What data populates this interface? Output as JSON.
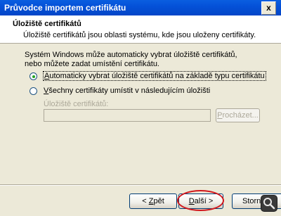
{
  "window": {
    "title": "Průvodce importem certifikátu",
    "close_symbol": "x"
  },
  "header": {
    "title": "Úložiště certifikátů",
    "subtitle": "Úložiště certifikátů jsou oblasti systému, kde jsou uloženy certifikáty."
  },
  "body": {
    "intro": "Systém Windows může automaticky vybrat úložiště certifikátů, nebo můžete zadat umístění certifikátu.",
    "option_auto": {
      "accel": "A",
      "rest": "utomaticky vybrat úložiště certifikátů na základě typu certifikátu",
      "selected": true
    },
    "option_manual": {
      "accel": "V",
      "rest": "šechny certifikáty umístit v následujícím úložišti",
      "selected": false
    },
    "store_label": "Úložiště certifikátů:",
    "store_value": "",
    "browse": {
      "accel": "P",
      "rest": "rocházet..."
    }
  },
  "footer": {
    "back": {
      "prefix": "< ",
      "accel": "Z",
      "rest": "pět"
    },
    "next": {
      "accel": "D",
      "rest": "alší",
      "suffix": " >"
    },
    "cancel": "Storno"
  },
  "icons": {
    "close": "close-icon",
    "overlay": "magnifier-icon"
  },
  "colors": {
    "title_bar": "#0A5FE0",
    "dialog_bg": "#ECE9D8",
    "highlight_ring": "#D2171C"
  }
}
